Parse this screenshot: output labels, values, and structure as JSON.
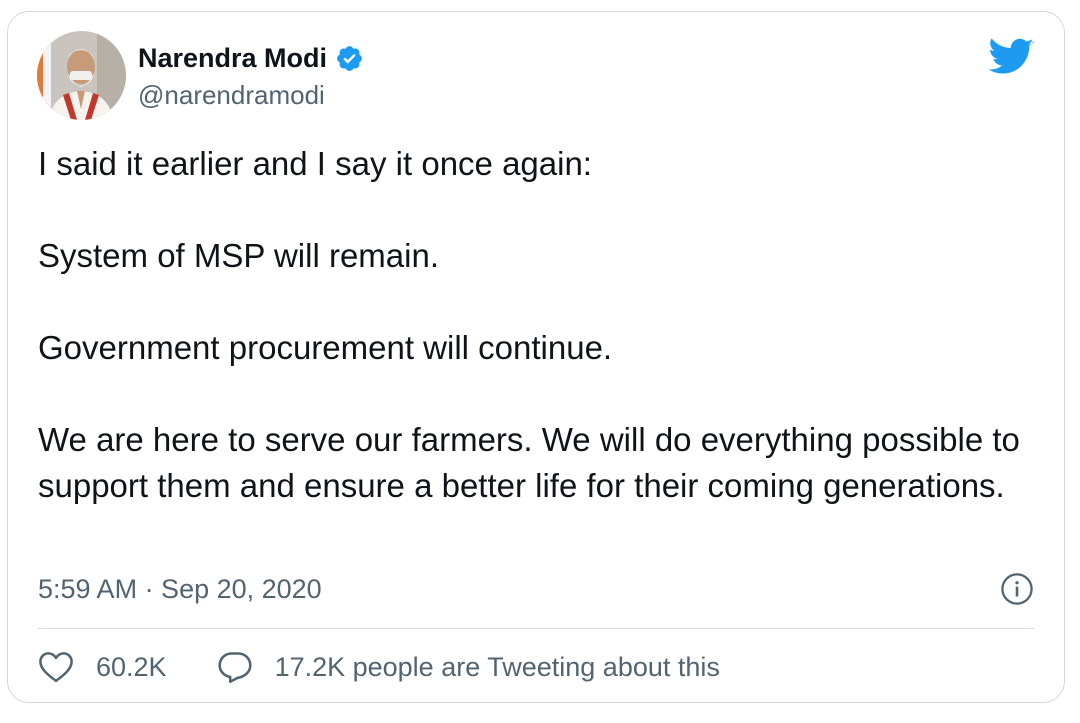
{
  "tweet": {
    "author_name": "Narendra Modi",
    "author_handle": "@narendramodi",
    "verified_icon": "verified-badge-icon",
    "brand_icon": "twitter-bird-icon",
    "paragraphs": [
      "I said it earlier and I say it once again:",
      "System of MSP will remain.",
      "Government procurement will continue.",
      "We are here to serve our farmers. We will do everything possible to support them and ensure a better life for their coming generations."
    ],
    "timestamp": "5:59 AM · Sep 20, 2020",
    "like_count": "60.2K",
    "reply_text": "17.2K people are Tweeting about this"
  },
  "colors": {
    "brand_blue": "#1d9bf0",
    "text_primary": "#0f1419",
    "text_secondary": "#536471",
    "border": "#cfd9de"
  }
}
